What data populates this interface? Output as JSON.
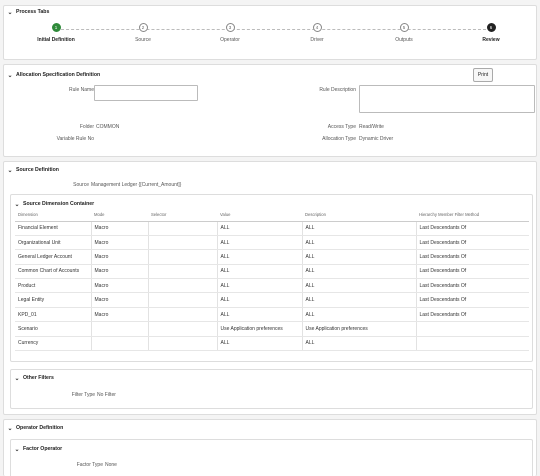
{
  "process_tabs": {
    "title": "Process Tabs",
    "steps": [
      {
        "num": "1",
        "label": "Initial Definition"
      },
      {
        "num": "2",
        "label": "Source"
      },
      {
        "num": "3",
        "label": "Operator"
      },
      {
        "num": "4",
        "label": "Driver"
      },
      {
        "num": "5",
        "label": "Outputs"
      },
      {
        "num": "6",
        "label": "Review"
      }
    ]
  },
  "allocation": {
    "title": "Allocation Specification Definition",
    "print_label": "Print",
    "rule_name_label": "Rule Name",
    "rule_name_value": "",
    "rule_description_label": "Rule Description",
    "rule_description_value": "",
    "folder_label": "Folder",
    "folder_value": "COMMON",
    "variable_rule_no_label": "Variable Rule No",
    "variable_rule_no_value": "",
    "access_type_label": "Access Type",
    "access_type_value": "Read/Write",
    "allocation_type_label": "Allocation Type",
    "allocation_type_value": "Dynamic Driver"
  },
  "source": {
    "title": "Source Definition",
    "source_label": "Source",
    "source_value": "Management Ledger {[Current_Amount]}",
    "dimension_container": {
      "title": "Source Dimension Container",
      "columns": [
        "Dimension",
        "Mode",
        "Selector",
        "Value",
        "Description",
        "Hierarchy Member Filter Method"
      ],
      "rows": [
        [
          "Financial Element",
          "Macro",
          "",
          "ALL",
          "ALL",
          "Last Descendants Of"
        ],
        [
          "Organizational Unit",
          "Macro",
          "",
          "ALL",
          "ALL",
          "Last Descendants Of"
        ],
        [
          "General Ledger Account",
          "Macro",
          "",
          "ALL",
          "ALL",
          "Last Descendants Of"
        ],
        [
          "Common Chart of Accounts",
          "Macro",
          "",
          "ALL",
          "ALL",
          "Last Descendants Of"
        ],
        [
          "Product",
          "Macro",
          "",
          "ALL",
          "ALL",
          "Last Descendants Of"
        ],
        [
          "Legal Entity",
          "Macro",
          "",
          "ALL",
          "ALL",
          "Last Descendants Of"
        ],
        [
          "KPD_01",
          "Macro",
          "",
          "ALL",
          "ALL",
          "Last Descendants Of"
        ],
        [
          "Scenario",
          "",
          "",
          "Use Application preferences",
          "Use Application preferences",
          ""
        ],
        [
          "Currency",
          "",
          "",
          "ALL",
          "ALL",
          ""
        ]
      ]
    },
    "other_filters": {
      "title": "Other Filters",
      "filter_type_label": "Filter Type",
      "filter_type_value": "No Filter"
    }
  },
  "operator": {
    "title": "Operator Definition",
    "factor_operator": {
      "title": "Factor Operator",
      "factor_type_label": "Factor Type",
      "factor_type_value": "None"
    }
  },
  "colors": {
    "step_done": "#2f8a3a",
    "step_current": "#222222",
    "border": "#dddddd"
  }
}
